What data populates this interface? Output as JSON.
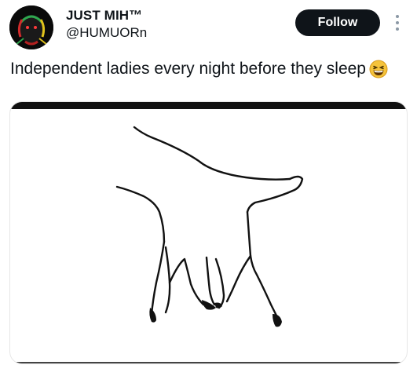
{
  "author": {
    "display_name": "JUST MIH™",
    "handle": "@HUMUORn"
  },
  "follow_button": {
    "label": "Follow"
  },
  "more_menu": {
    "icon": "more-vertical-icon"
  },
  "tweet": {
    "text": "Independent ladies every night before they sleep",
    "emoji": "grinning-squinting-face-icon"
  },
  "media": {
    "icon": "hand-drawing-image"
  },
  "colors": {
    "text": "#0f1419",
    "follow_bg": "#0f1419",
    "follow_text": "#ffffff",
    "media_border": "#e6e6e6"
  }
}
